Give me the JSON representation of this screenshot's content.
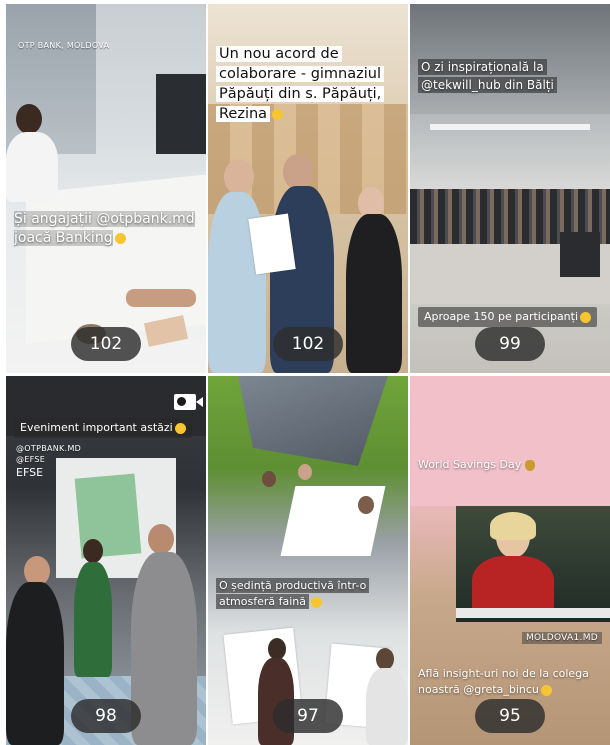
{
  "posts": [
    {
      "location_tag": "OTP BANK, MOLDOVA",
      "caption": "Și angajații @otpbank.md joacă Banking",
      "count": "102"
    },
    {
      "caption": "Un nou acord de colaborare - gimnaziul Păpăuți din s. Păpăuți, Rezina",
      "count": "102"
    },
    {
      "caption_top": "O zi inspirațională la @tekwill_hub din Bălți",
      "caption_bottom": "Aproape 150 pe participanți",
      "count": "99"
    },
    {
      "caption": "Eveniment important astăzi",
      "tag1": "@OTPBANK.MD",
      "tag2": "@EFSE",
      "slide_text": "EFSE",
      "count": "98"
    },
    {
      "caption": "O ședință productivă într-o atmosferă faină",
      "count": "97"
    },
    {
      "caption_top": "World Savings Day",
      "tag": "MOLDOVA1.MD",
      "caption_bottom": "Află insight-uri noi de la colega noastră @greta_bincu",
      "count": "95"
    }
  ],
  "icons": {
    "reel": "video-camera-icon",
    "emoji": "smiling-face-icon",
    "money": "money-bag-icon"
  }
}
